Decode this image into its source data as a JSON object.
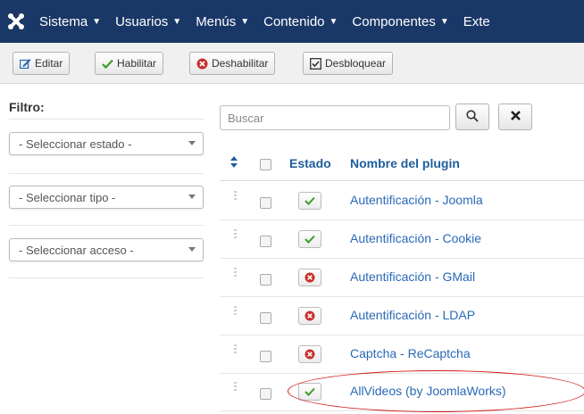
{
  "nav": {
    "items": [
      {
        "label": "Sistema",
        "caret": true
      },
      {
        "label": "Usuarios",
        "caret": true
      },
      {
        "label": "Menús",
        "caret": true
      },
      {
        "label": "Contenido",
        "caret": true
      },
      {
        "label": "Componentes",
        "caret": true
      },
      {
        "label": "Exte",
        "caret": false
      }
    ]
  },
  "toolbar": {
    "edit_label": "Editar",
    "enable_label": "Habilitar",
    "disable_label": "Deshabilitar",
    "unlock_label": "Desbloquear"
  },
  "sidebar": {
    "filter_label": "Filtro:",
    "state_select": "- Seleccionar estado -",
    "type_select": "- Seleccionar tipo -",
    "access_select": "- Seleccionar acceso -"
  },
  "search": {
    "placeholder": "Buscar"
  },
  "table": {
    "col_status": "Estado",
    "col_name": "Nombre del plugin",
    "rows": [
      {
        "name": "Autentificación - Joomla",
        "enabled": true
      },
      {
        "name": "Autentificación - Cookie",
        "enabled": true
      },
      {
        "name": "Autentificación - GMail",
        "enabled": false
      },
      {
        "name": "Autentificación - LDAP",
        "enabled": false
      },
      {
        "name": "Captcha - ReCaptcha",
        "enabled": false
      },
      {
        "name": "AllVideos (by JoomlaWorks)",
        "enabled": true
      }
    ]
  },
  "colors": {
    "navbar": "#1a3867",
    "link": "#2a69b8",
    "enabled": "#3c9c27",
    "disabled": "#c9302c",
    "annotation": "#d11a1a"
  }
}
